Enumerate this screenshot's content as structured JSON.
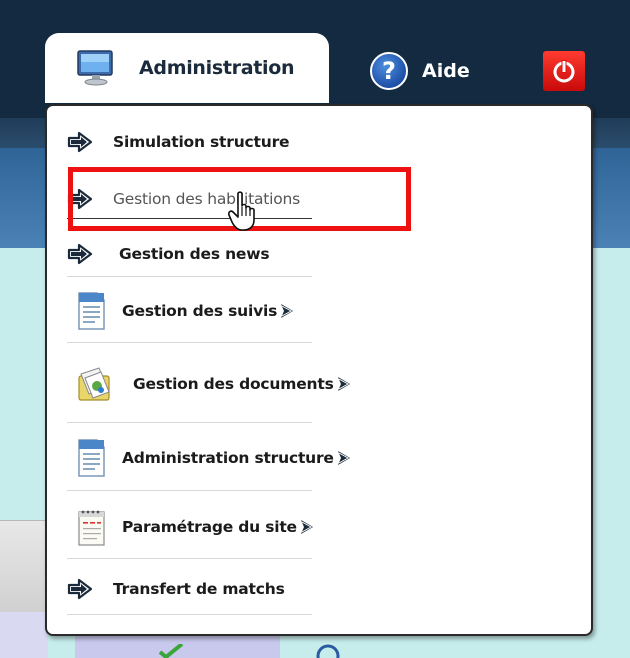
{
  "nav": {
    "administration_label": "Administration",
    "aide_label": "Aide"
  },
  "menu": {
    "items": [
      {
        "label": "Simulation structure",
        "icon": "arrow-right-icon",
        "submenu": false
      },
      {
        "label": "Gestion des habilitations",
        "icon": "arrow-right-icon",
        "submenu": false,
        "state": "hover"
      },
      {
        "label": "Gestion des news",
        "icon": "arrow-right-icon",
        "submenu": false
      },
      {
        "label": "Gestion des suivis",
        "icon": "document-icon",
        "submenu": true
      },
      {
        "label": "Gestion des documents",
        "icon": "documents-folder-icon",
        "submenu": true
      },
      {
        "label": "Administration structure",
        "icon": "document-icon",
        "submenu": true
      },
      {
        "label": "Paramétrage du site",
        "icon": "notepad-icon",
        "submenu": true
      },
      {
        "label": "Transfert de matchs",
        "icon": "arrow-right-icon",
        "submenu": false
      }
    ]
  },
  "colors": {
    "topbar": "#132a40",
    "highlight": "#ee1111",
    "content_background": "#c6ecec"
  }
}
